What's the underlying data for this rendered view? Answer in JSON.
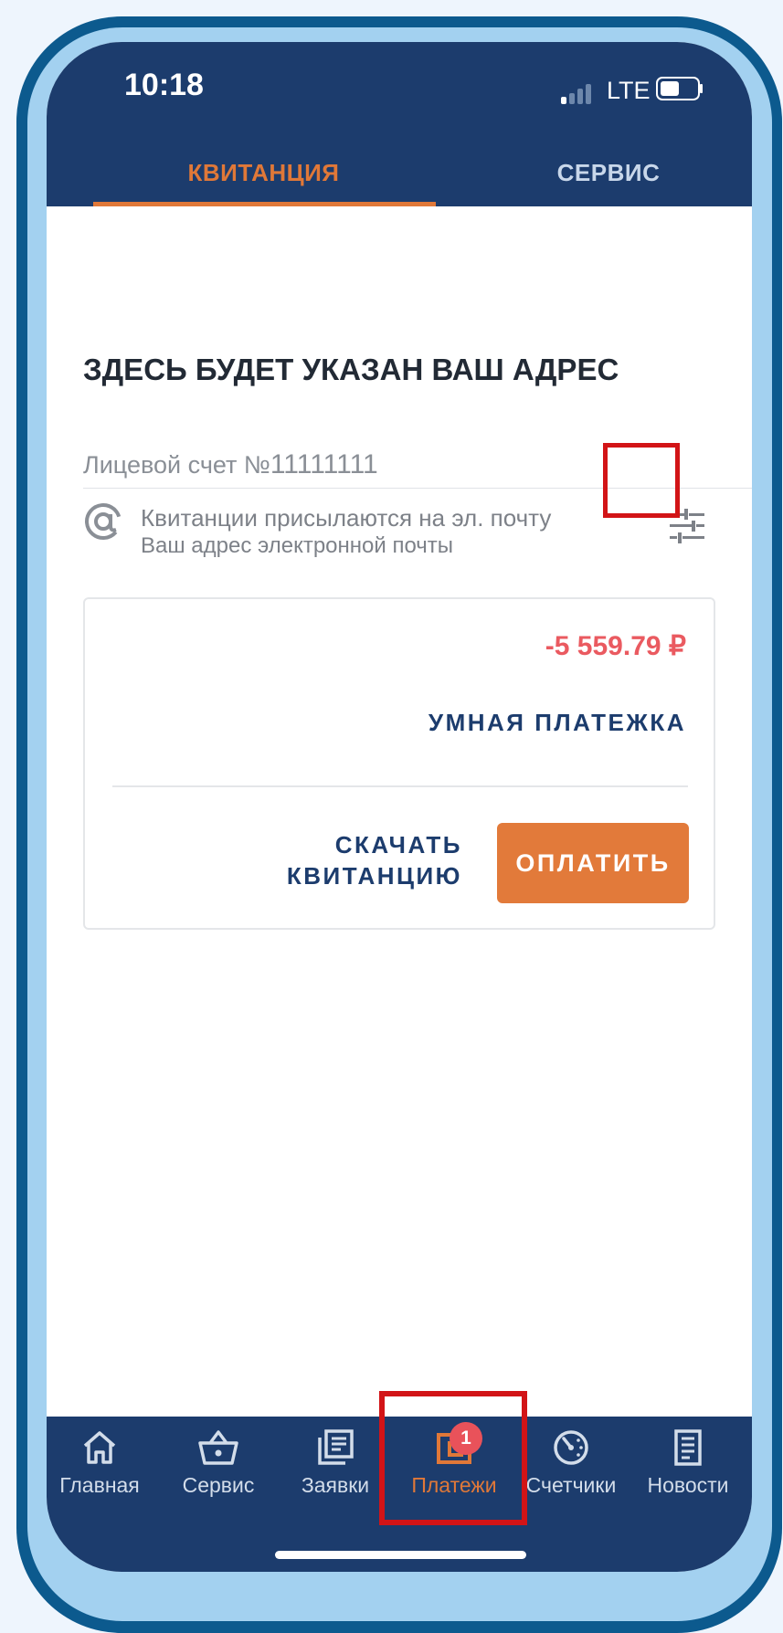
{
  "status_bar": {
    "time": "10:18",
    "network": "LTE"
  },
  "tabs": [
    {
      "label": "КВИТАНЦИЯ",
      "active": true
    },
    {
      "label": "СЕРВИС",
      "active": false
    }
  ],
  "address_heading": "ЗДЕСЬ БУДЕТ УКАЗАН ВАШ АДРЕС",
  "account": {
    "label": "Лицевой счет №",
    "number": "11111111"
  },
  "email": {
    "line1": "Квитанции присылаются на эл. почту",
    "line2": "Ваш адрес электронной почты"
  },
  "card": {
    "amount": "-5 559.79 ₽",
    "smart_payment": "УМНАЯ ПЛАТЕЖКА",
    "download_line1": "СКАЧАТЬ",
    "download_line2": "КВИТАНЦИЮ",
    "pay_button": "ОПЛАТИТЬ"
  },
  "bottom_nav": [
    {
      "label": "Главная",
      "icon": "home-icon"
    },
    {
      "label": "Сервис",
      "icon": "basket-icon"
    },
    {
      "label": "Заявки",
      "icon": "requests-icon"
    },
    {
      "label": "Платежи",
      "icon": "payments-icon",
      "active": true,
      "badge": "1"
    },
    {
      "label": "Счетчики",
      "icon": "meter-icon"
    },
    {
      "label": "Новости",
      "icon": "news-icon"
    }
  ],
  "colors": {
    "primary": "#1c3c6d",
    "accent": "#e07838",
    "negative_amount": "#ea5a60",
    "highlight": "#d21417"
  }
}
